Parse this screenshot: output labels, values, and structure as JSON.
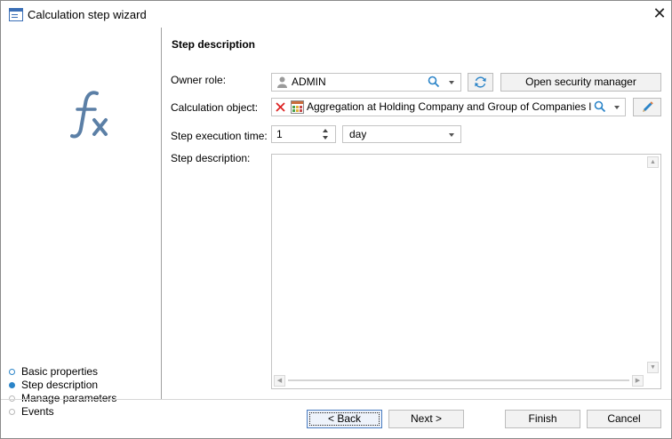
{
  "window": {
    "title": "Calculation step wizard",
    "close_glyph": "✕"
  },
  "sidebar": {
    "steps": [
      {
        "label": "Basic properties",
        "state": "done"
      },
      {
        "label": "Step description",
        "state": "active"
      },
      {
        "label": "Manage parameters",
        "state": "future"
      },
      {
        "label": "Events",
        "state": "future"
      }
    ]
  },
  "main": {
    "section_title": "Step description",
    "owner_role": {
      "label": "Owner role:",
      "value": "ADMIN",
      "icon": "user-icon"
    },
    "open_security_label": "Open security manager",
    "calculation_object": {
      "label": "Calculation object:",
      "value": "Aggregation at Holding Company and Group of Companies level. In"
    },
    "execution_time": {
      "label": "Step execution time:",
      "value": "1",
      "unit": "day"
    },
    "description": {
      "label": "Step description:",
      "value": ""
    }
  },
  "footer": {
    "back_label": "< Back",
    "next_label": "Next >",
    "finish_label": "Finish",
    "cancel_label": "Cancel"
  },
  "colors": {
    "accent": "#2b84c8",
    "fx_icon": "#5b7fa6"
  }
}
